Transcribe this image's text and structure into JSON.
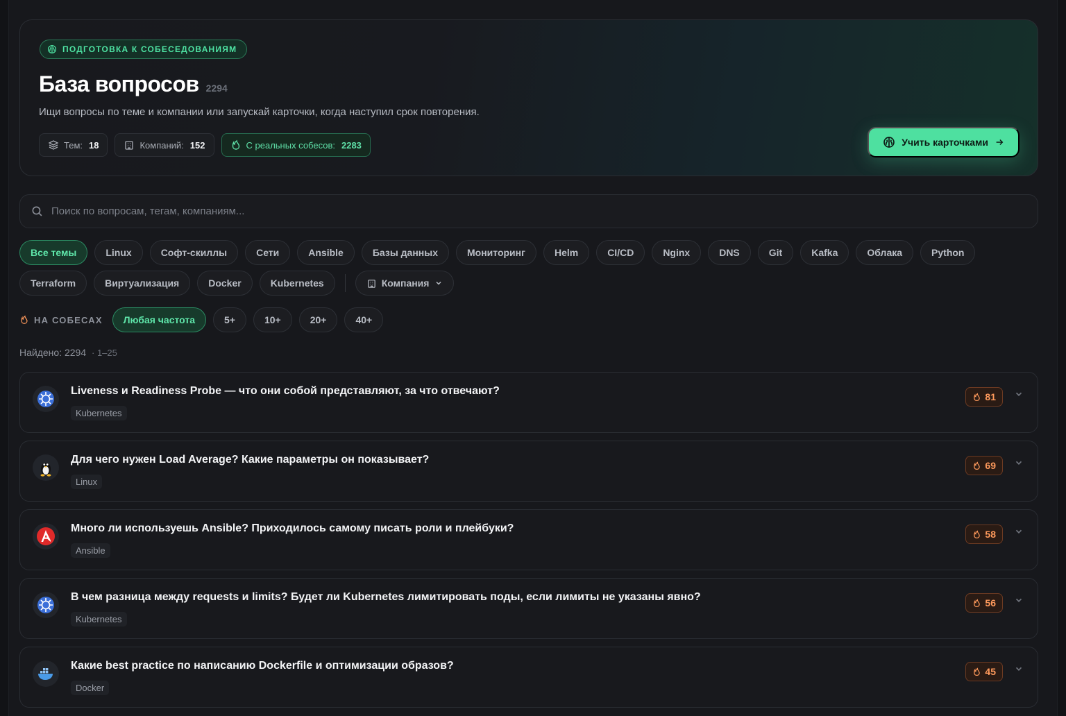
{
  "hero": {
    "badge": "ПОДГОТОВКА К СОБЕСЕДОВАНИЯМ",
    "title": "База вопросов",
    "count": "2294",
    "subtitle": "Ищи вопросы по теме и компании или запускай карточки, когда наступил срок повторения.",
    "stats": [
      {
        "label": "Тем:",
        "value": "18"
      },
      {
        "label": "Компаний:",
        "value": "152"
      },
      {
        "label": "С реальных собесов:",
        "value": "2283"
      }
    ],
    "cta_label": "Учить карточками"
  },
  "search": {
    "placeholder": "Поиск по вопросам, тегам, компаниям..."
  },
  "topics_row1": [
    "Все темы",
    "Linux",
    "Софт-скиллы",
    "Сети",
    "Ansible",
    "Базы данных",
    "Мониторинг",
    "Helm",
    "CI/CD",
    "Nginx",
    "DNS",
    "Git",
    "Kafka",
    "Облака",
    "Python"
  ],
  "topics_row2": [
    "Terraform",
    "Виртуализация",
    "Docker",
    "Kubernetes"
  ],
  "company_filter_label": "Компания",
  "frequency": {
    "label": "НА СОБЕСАХ",
    "options": [
      "Любая частота",
      "5+",
      "10+",
      "20+",
      "40+"
    ]
  },
  "results": {
    "found": "Найдено: 2294",
    "range": "· 1–25"
  },
  "questions": [
    {
      "title": "Liveness и Readiness Probe — что они собой представляют, за что отвечают?",
      "tag": "Kubernetes",
      "count": "81",
      "icon": "kubernetes-icon"
    },
    {
      "title": "Для чего нужен Load Average? Какие параметры он показывает?",
      "tag": "Linux",
      "count": "69",
      "icon": "linux-icon"
    },
    {
      "title": "Много ли используешь Ansible? Приходилось самому писать роли и плейбуки?",
      "tag": "Ansible",
      "count": "58",
      "icon": "ansible-icon"
    },
    {
      "title": "В чем разница между requests и limits? Будет ли Kubernetes лимитировать поды, если лимиты не указаны явно?",
      "tag": "Kubernetes",
      "count": "56",
      "icon": "kubernetes-icon"
    },
    {
      "title": "Какие best practice по написанию Dockerfile и оптимизации образов?",
      "tag": "Docker",
      "count": "45",
      "icon": "docker-icon"
    }
  ],
  "colors": {
    "accent": "#4ee0a0",
    "hot": "#ff9a5c",
    "background": "#17181c"
  }
}
